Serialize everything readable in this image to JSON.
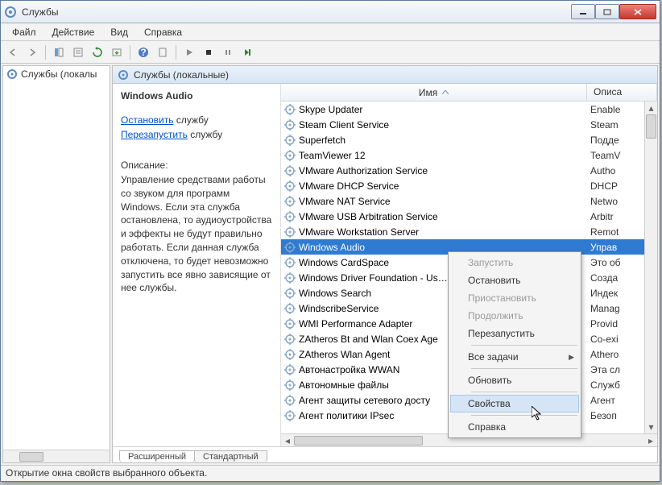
{
  "title": "Службы",
  "menu": [
    "Файл",
    "Действие",
    "Вид",
    "Справка"
  ],
  "left_tree_item": "Службы (локалы",
  "right_head": "Службы (локальные)",
  "columns": {
    "name": "Имя",
    "desc": "Описа"
  },
  "detail": {
    "service_name": "Windows Audio",
    "action_stop": "Остановить",
    "action_restart": "Перезапустить",
    "action_suffix": " службу",
    "desc_label": "Описание:",
    "desc_text": "Управление средствами работы со звуком для программ Windows. Если эта служба остановлена, то аудиоустройства и эффекты не будут правильно работать. Если данная служба отключена, то будет невозможно запустить все явно зависящие от нее службы."
  },
  "services": [
    {
      "name": "Skype Updater",
      "desc": "Enable"
    },
    {
      "name": "Steam Client Service",
      "desc": "Steam"
    },
    {
      "name": "Superfetch",
      "desc": "Подде"
    },
    {
      "name": "TeamViewer 12",
      "desc": "TeamV"
    },
    {
      "name": "VMware Authorization Service",
      "desc": "Autho"
    },
    {
      "name": "VMware DHCP Service",
      "desc": "DHCP"
    },
    {
      "name": "VMware NAT Service",
      "desc": "Netwo"
    },
    {
      "name": "VMware USB Arbitration Service",
      "desc": "Arbitr"
    },
    {
      "name": "VMware Workstation Server",
      "desc": "Remot"
    },
    {
      "name": "Windows Audio",
      "desc": "Управ",
      "selected": true
    },
    {
      "name": "Windows CardSpace",
      "desc": "Это об"
    },
    {
      "name": "Windows Driver Foundation - Us…",
      "desc": "Созда"
    },
    {
      "name": "Windows Search",
      "desc": "Индек"
    },
    {
      "name": "WindscribeService",
      "desc": "Manag"
    },
    {
      "name": "WMI Performance Adapter",
      "desc": "Provid"
    },
    {
      "name": "ZAtheros Bt and Wlan Coex Age",
      "desc": "Co-exi"
    },
    {
      "name": "ZAtheros Wlan Agent",
      "desc": "Athero"
    },
    {
      "name": "Автонастройка WWAN",
      "desc": "Эта сл"
    },
    {
      "name": "Автономные файлы",
      "desc": "Служб"
    },
    {
      "name": "Агент защиты сетевого досту",
      "desc": "Агент"
    },
    {
      "name": "Агент политики IPsec",
      "desc": "Безоп"
    }
  ],
  "context_menu": [
    {
      "label": "Запустить",
      "disabled": true
    },
    {
      "label": "Остановить"
    },
    {
      "label": "Приостановить",
      "disabled": true
    },
    {
      "label": "Продолжить",
      "disabled": true
    },
    {
      "label": "Перезапустить"
    },
    {
      "sep": true
    },
    {
      "label": "Все задачи",
      "submenu": true
    },
    {
      "sep": true
    },
    {
      "label": "Обновить"
    },
    {
      "sep": true
    },
    {
      "label": "Свойства",
      "hover": true
    },
    {
      "sep": true
    },
    {
      "label": "Справка"
    }
  ],
  "tabs": {
    "extended": "Расширенный",
    "standard": "Стандартный"
  },
  "status": "Открытие окна свойств выбранного объекта."
}
